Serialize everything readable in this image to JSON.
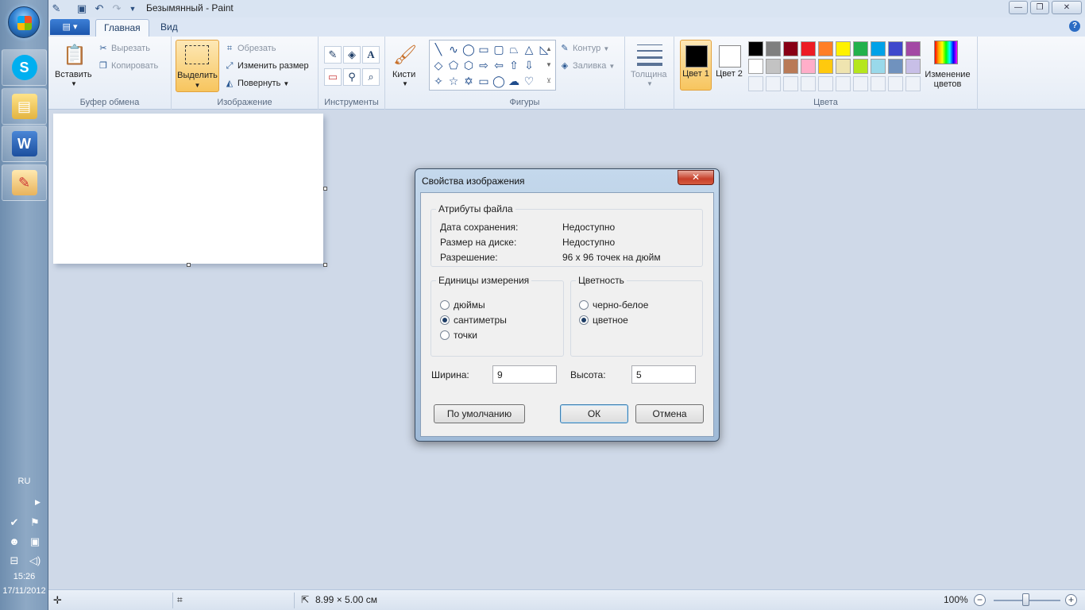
{
  "window": {
    "title": "Безымянный - Paint",
    "minimize": "—",
    "maximize": "❐",
    "close": "✕"
  },
  "taskbar": {
    "lang": "RU",
    "time": "15:26",
    "date": "17/11/2012"
  },
  "tabs": {
    "app_menu": "▤ ▾",
    "home": "Главная",
    "view": "Вид",
    "help": "?"
  },
  "ribbon": {
    "clipboard": {
      "group": "Буфер обмена",
      "paste": "Вставить",
      "cut": "Вырезать",
      "copy": "Копировать"
    },
    "image": {
      "group": "Изображение",
      "select": "Выделить",
      "crop": "Обрезать",
      "resize": "Изменить размер",
      "rotate": "Повернуть"
    },
    "tools": {
      "group": "Инструменты"
    },
    "brushes": {
      "label": "Кисти"
    },
    "shapes": {
      "group": "Фигуры",
      "outline": "Контур",
      "fill": "Заливка"
    },
    "size": {
      "label": "Толщина"
    },
    "colors": {
      "group": "Цвета",
      "color1": "Цвет 1",
      "color2": "Цвет 2",
      "edit": "Изменение цветов",
      "color1_value": "#000000",
      "color2_value": "#ffffff",
      "palette_row1": [
        "#000000",
        "#7f7f7f",
        "#880015",
        "#ed1c24",
        "#ff7f27",
        "#fff200",
        "#22b14c",
        "#00a2e8",
        "#3f48cc",
        "#a349a4"
      ],
      "palette_row2": [
        "#ffffff",
        "#c3c3c3",
        "#b97a57",
        "#ffaec9",
        "#ffc90e",
        "#efe4b0",
        "#b5e61d",
        "#99d9ea",
        "#7092be",
        "#c8bfe7"
      ]
    }
  },
  "dialog": {
    "title": "Свойства изображения",
    "file_attrs": {
      "legend": "Атрибуты файла",
      "saved_label": "Дата сохранения:",
      "saved_value": "Недоступно",
      "size_label": "Размер на диске:",
      "size_value": "Недоступно",
      "res_label": "Разрешение:",
      "res_value": "96 x 96 точек на дюйм"
    },
    "units": {
      "legend": "Единицы измерения",
      "inches": "дюймы",
      "cm": "сантиметры",
      "pixels": "точки",
      "selected": "cm"
    },
    "colors": {
      "legend": "Цветность",
      "bw": "черно-белое",
      "color": "цветное",
      "selected": "color"
    },
    "width_label": "Ширина:",
    "width_value": "9",
    "height_label": "Высота:",
    "height_value": "5",
    "default_btn": "По умолчанию",
    "ok_btn": "ОК",
    "cancel_btn": "Отмена"
  },
  "statusbar": {
    "dimensions": "8.99 × 5.00 см",
    "zoom": "100%",
    "zoom_minus": "−",
    "zoom_plus": "+"
  }
}
